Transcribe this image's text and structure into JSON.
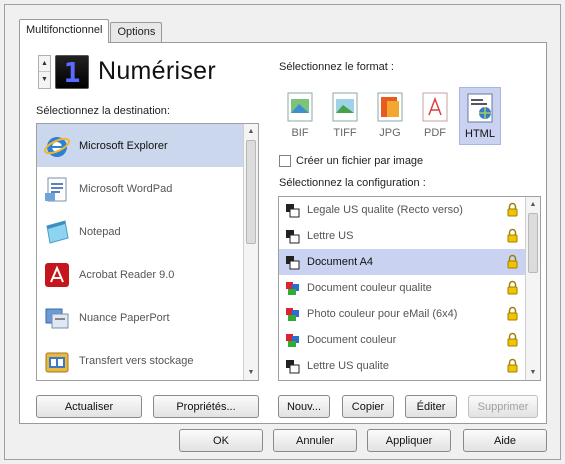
{
  "tabs": [
    {
      "label": "Multifonctionnel",
      "active": true
    },
    {
      "label": "Options",
      "active": false
    }
  ],
  "counter": "1",
  "scan_title": "Numériser",
  "destination": {
    "label": "Sélectionnez la destination:",
    "items": [
      {
        "label": "Microsoft Explorer",
        "icon": "ie-icon",
        "selected": true
      },
      {
        "label": "Microsoft WordPad",
        "icon": "wordpad-icon",
        "selected": false
      },
      {
        "label": "Notepad",
        "icon": "notepad-icon",
        "selected": false
      },
      {
        "label": "Acrobat Reader 9.0",
        "icon": "acrobat-icon",
        "selected": false
      },
      {
        "label": "Nuance PaperPort",
        "icon": "paperport-icon",
        "selected": false
      },
      {
        "label": "Transfert vers stockage",
        "icon": "storage-icon",
        "selected": false
      }
    ],
    "buttons": {
      "refresh": "Actualiser",
      "properties": "Propriétés..."
    }
  },
  "format": {
    "label": "Sélectionnez le format :",
    "items": [
      {
        "label": "BIF",
        "icon": "bmp-file-icon",
        "selected": false
      },
      {
        "label": "TIFF",
        "icon": "tiff-file-icon",
        "selected": false
      },
      {
        "label": "JPG",
        "icon": "jpg-file-icon",
        "selected": false
      },
      {
        "label": "PDF",
        "icon": "pdf-file-icon",
        "selected": false
      },
      {
        "label": "HTML",
        "icon": "html-file-icon",
        "selected": true
      }
    ],
    "checkbox_label": "Créer un fichier par image"
  },
  "configuration": {
    "label": "Sélectionnez la configuration :",
    "items": [
      {
        "label": "Legale US qualite (Recto verso)",
        "color": false,
        "selected": false
      },
      {
        "label": "Lettre US",
        "color": false,
        "selected": false
      },
      {
        "label": "Document A4",
        "color": false,
        "selected": true
      },
      {
        "label": "Document couleur qualite",
        "color": true,
        "selected": false
      },
      {
        "label": "Photo couleur pour eMail (6x4)",
        "color": true,
        "selected": false
      },
      {
        "label": "Document couleur",
        "color": true,
        "selected": false
      },
      {
        "label": "Lettre US qualite",
        "color": false,
        "selected": false
      }
    ],
    "buttons": {
      "new": "Nouv...",
      "copy": "Copier",
      "edit": "Éditer",
      "delete": "Supprimer"
    }
  },
  "footer": {
    "ok": "OK",
    "cancel": "Annuler",
    "apply": "Appliquer",
    "help": "Aide"
  },
  "colors": {
    "selection": "#c9d2f1",
    "accent": "#5a6cff"
  }
}
